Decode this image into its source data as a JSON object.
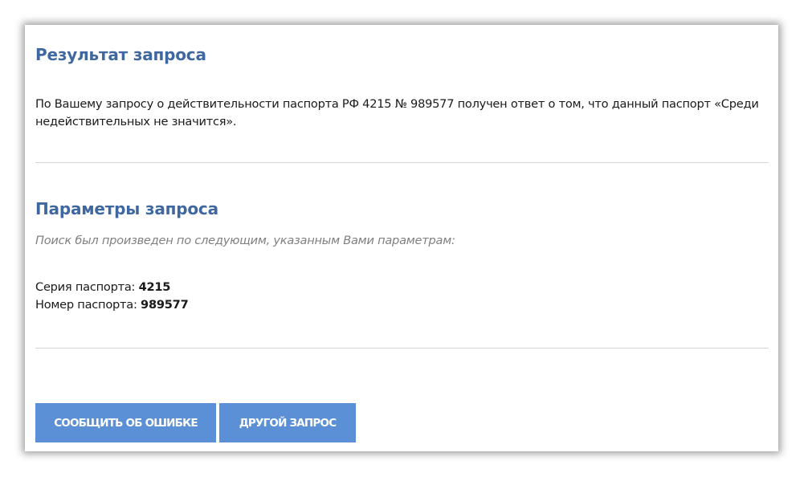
{
  "result": {
    "title": "Результат запроса",
    "text": "По Вашему запросу о действительности паспорта РФ 4215 № 989577 получен ответ о том, что данный паспорт «Среди недействительных не значится»."
  },
  "params": {
    "title": "Параметры запроса",
    "note": "Поиск был произведен по следующим, указанным Вами параметрам:",
    "series_label": "Серия паспорта: ",
    "series_value": "4215",
    "number_label": "Номер паспорта: ",
    "number_value": "989577"
  },
  "actions": {
    "report_error_label": "Сообщить об ошибке",
    "other_request_label": "Другой запрос"
  },
  "colors": {
    "accent": "#3f67a0",
    "button": "#5b8fd6",
    "note": "#808080",
    "divider": "#d3d3d3"
  }
}
